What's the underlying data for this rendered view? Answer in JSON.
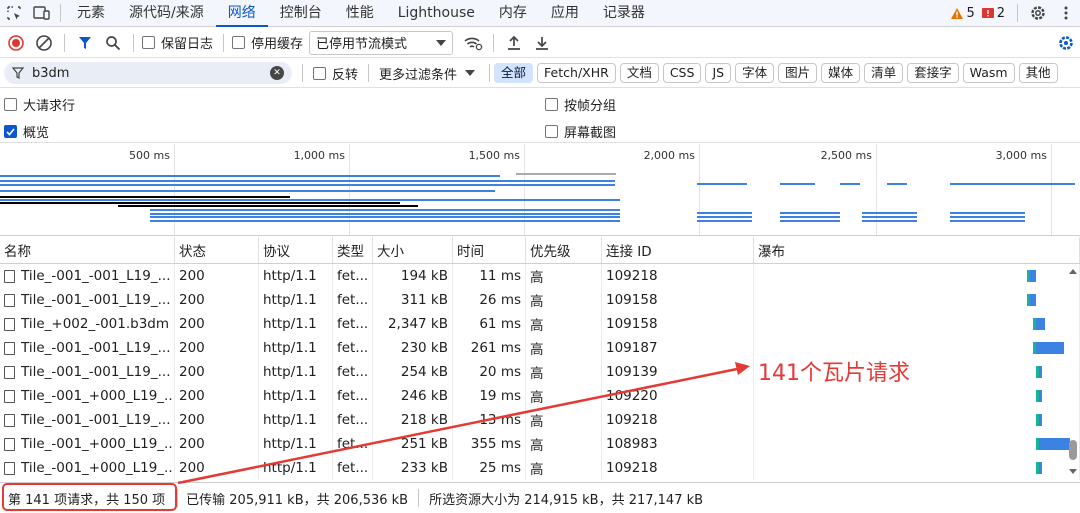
{
  "tabs": [
    "元素",
    "源代码/来源",
    "网络",
    "控制台",
    "性能",
    "Lighthouse",
    "内存",
    "应用",
    "记录器"
  ],
  "active_tab_index": 2,
  "issues": {
    "warnings": "5",
    "errors": "2"
  },
  "toolbar": {
    "preserve_log": "保留日志",
    "disable_cache": "停用缓存",
    "throttle_value": "已停用节流模式"
  },
  "filter": {
    "search_value": "b3dm",
    "invert": "反转",
    "more_filters": "更多过滤条件",
    "types": [
      "全部",
      "Fetch/XHR",
      "文档",
      "CSS",
      "JS",
      "字体",
      "图片",
      "媒体",
      "清单",
      "套接字",
      "Wasm",
      "其他"
    ]
  },
  "options": {
    "big_requests": "大请求行",
    "group_by_frame": "按帧分组",
    "overview": "概览",
    "screenshots": "屏幕截图"
  },
  "overview": {
    "ticks": [
      "500 ms",
      "1,000 ms",
      "1,500 ms",
      "2,000 ms",
      "2,500 ms",
      "3,000 ms"
    ]
  },
  "table": {
    "headers": [
      "名称",
      "状态",
      "协议",
      "类型",
      "大小",
      "时间",
      "优先级",
      "连接 ID",
      "瀑布"
    ],
    "rows": [
      {
        "name": "Tile_-001_-001_L19_...",
        "status": "200",
        "protocol": "http/1.1",
        "type": "fet...",
        "size": "194 kB",
        "time": "11 ms",
        "priority": "高",
        "conn": "109218",
        "wf_start": 0.86,
        "wf_len": 0.02
      },
      {
        "name": "Tile_-001_-001_L19_...",
        "status": "200",
        "protocol": "http/1.1",
        "type": "fet...",
        "size": "311 kB",
        "time": "26 ms",
        "priority": "高",
        "conn": "109158",
        "wf_start": 0.86,
        "wf_len": 0.02
      },
      {
        "name": "Tile_+002_-001.b3dm",
        "status": "200",
        "protocol": "http/1.1",
        "type": "fet...",
        "size": "2,347 kB",
        "time": "61 ms",
        "priority": "高",
        "conn": "109158",
        "wf_start": 0.88,
        "wf_len": 0.03
      },
      {
        "name": "Tile_-001_-001_L19_...",
        "status": "200",
        "protocol": "http/1.1",
        "type": "fet...",
        "size": "230 kB",
        "time": "261 ms",
        "priority": "高",
        "conn": "109187",
        "wf_start": 0.88,
        "wf_len": 0.09
      },
      {
        "name": "Tile_-001_-001_L19_...",
        "status": "200",
        "protocol": "http/1.1",
        "type": "fet...",
        "size": "254 kB",
        "time": "20 ms",
        "priority": "高",
        "conn": "109139",
        "wf_start": 0.89,
        "wf_len": 0.01
      },
      {
        "name": "Tile_-001_+000_L19_...",
        "status": "200",
        "protocol": "http/1.1",
        "type": "fet...",
        "size": "246 kB",
        "time": "19 ms",
        "priority": "高",
        "conn": "109220",
        "wf_start": 0.89,
        "wf_len": 0.01
      },
      {
        "name": "Tile_-001_-001_L19_...",
        "status": "200",
        "protocol": "http/1.1",
        "type": "fet...",
        "size": "218 kB",
        "time": "13 ms",
        "priority": "高",
        "conn": "109218",
        "wf_start": 0.89,
        "wf_len": 0.01
      },
      {
        "name": "Tile_-001_+000_L19_...",
        "status": "200",
        "protocol": "http/1.1",
        "type": "fet...",
        "size": "251 kB",
        "time": "355 ms",
        "priority": "高",
        "conn": "108983",
        "wf_start": 0.89,
        "wf_len": 0.1
      },
      {
        "name": "Tile_-001_+000_L19_...",
        "status": "200",
        "protocol": "http/1.1",
        "type": "fet...",
        "size": "233 kB",
        "time": "25 ms",
        "priority": "高",
        "conn": "109218",
        "wf_start": 0.89,
        "wf_len": 0.01
      }
    ]
  },
  "status": {
    "count": "第 141 项请求，共 150 项",
    "transferred": "已传输 205,911 kB，共 206,536 kB",
    "resources": "所选资源大小为 214,915 kB，共 217,147 kB"
  },
  "annotation": "141个瓦片请求",
  "colors": {
    "accent": "#0b57d0",
    "red": "#e53935",
    "bar": "#3b82e3"
  }
}
